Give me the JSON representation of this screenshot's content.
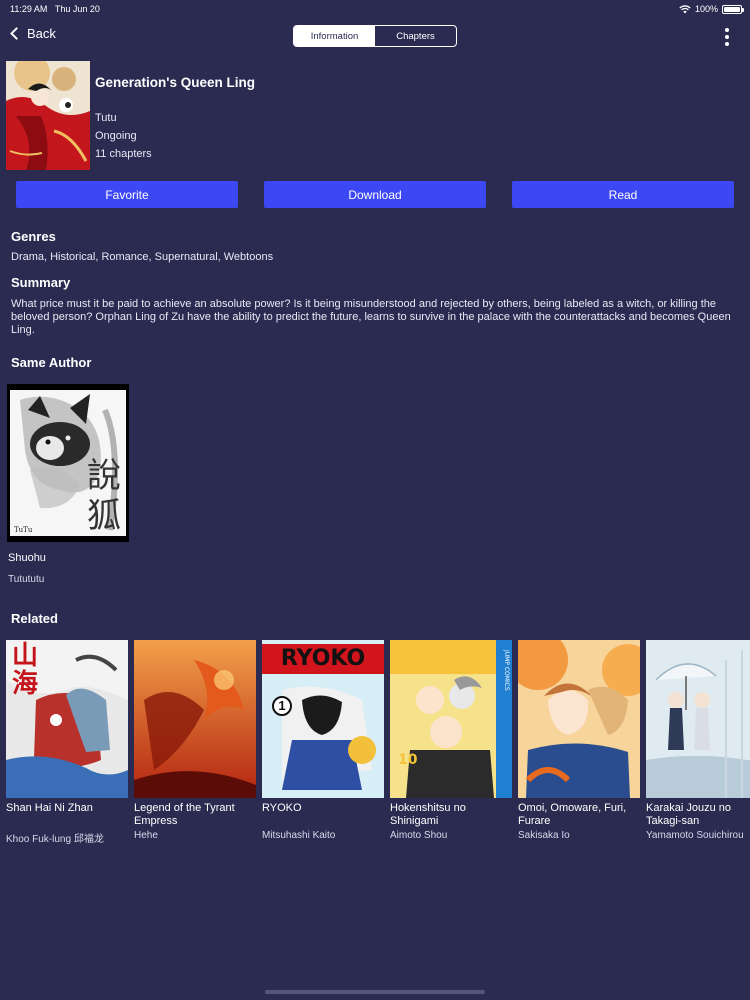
{
  "status_bar": {
    "time": "11:29 AM",
    "date": "Thu Jun 20",
    "battery": "100%",
    "battery_level": 1.0
  },
  "nav": {
    "back_label": "Back",
    "tabs": [
      {
        "label": "Information",
        "active": true
      },
      {
        "label": "Chapters",
        "active": false
      }
    ]
  },
  "book": {
    "title": "Generation's Queen Ling",
    "author": "Tutu",
    "status": "Ongoing",
    "chapters": "11 chapters"
  },
  "actions": {
    "favorite": "Favorite",
    "download": "Download",
    "read": "Read"
  },
  "genres": {
    "heading": "Genres",
    "text": "Drama, Historical, Romance, Supernatural, Webtoons"
  },
  "summary": {
    "heading": "Summary",
    "text": "What price must it be paid to achieve an absolute power? Is it being misunderstood and rejected by others, being labeled as a witch, or killing the beloved person? Orphan Ling of Zu have the ability to predict the future, learns to survive in the palace with the counterattacks and becomes Queen Ling."
  },
  "same_author": {
    "heading": "Same Author",
    "items": [
      {
        "title": "Shuohu",
        "author": "Tutututu",
        "cover_text": "說狐",
        "cover_sign": "TuTu"
      }
    ]
  },
  "related": {
    "heading": "Related",
    "items": [
      {
        "title": "Shan Hai Ni Zhan",
        "author": "Khoo Fuk-lung 邱福龙",
        "cover_text": "山海"
      },
      {
        "title": "Legend of the Tyrant Empress",
        "author": "Hehe"
      },
      {
        "title": "RYOKO",
        "author": "Mitsuhashi Kaito",
        "cover_text": "RYOKO",
        "cover_number": "1"
      },
      {
        "title": "Hokenshitsu no Shinigami",
        "author": "Aimoto Shou",
        "cover_number": "10",
        "cover_side": "JUMP COMICS"
      },
      {
        "title": "Omoi, Omoware, Furi, Furare",
        "author": "Sakisaka Io"
      },
      {
        "title": "Karakai Jouzu no Takagi-san",
        "author": "Yamamoto Souichirou"
      }
    ]
  },
  "colors": {
    "background": "#2b2b52",
    "accent_button": "#3d48f5",
    "text": "#ffffff"
  }
}
